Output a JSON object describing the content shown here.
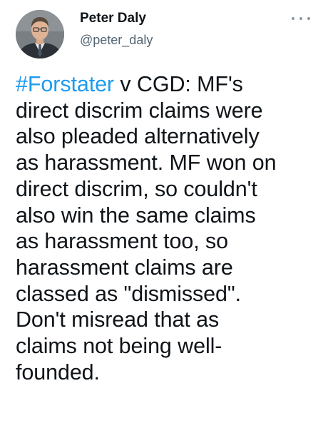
{
  "author": {
    "display_name": "Peter Daly",
    "handle": "@peter_daly"
  },
  "menu": {
    "more_icon": "more-horizontal-icon"
  },
  "tweet": {
    "hashtag": "#Forstater",
    "lines": [
      " v CGD:  MF's",
      "direct discrim claims were",
      "also pleaded alternatively",
      "as harassment. MF won on",
      "direct discrim, so couldn't",
      "also win the same claims",
      "as harassment too, so",
      "harassment claims are",
      "classed as \"dismissed\".",
      "Don't misread that as",
      "claims not being well-",
      "founded."
    ]
  },
  "colors": {
    "link": "#1d9bf0",
    "text": "#0f1419",
    "secondary": "#536471"
  }
}
